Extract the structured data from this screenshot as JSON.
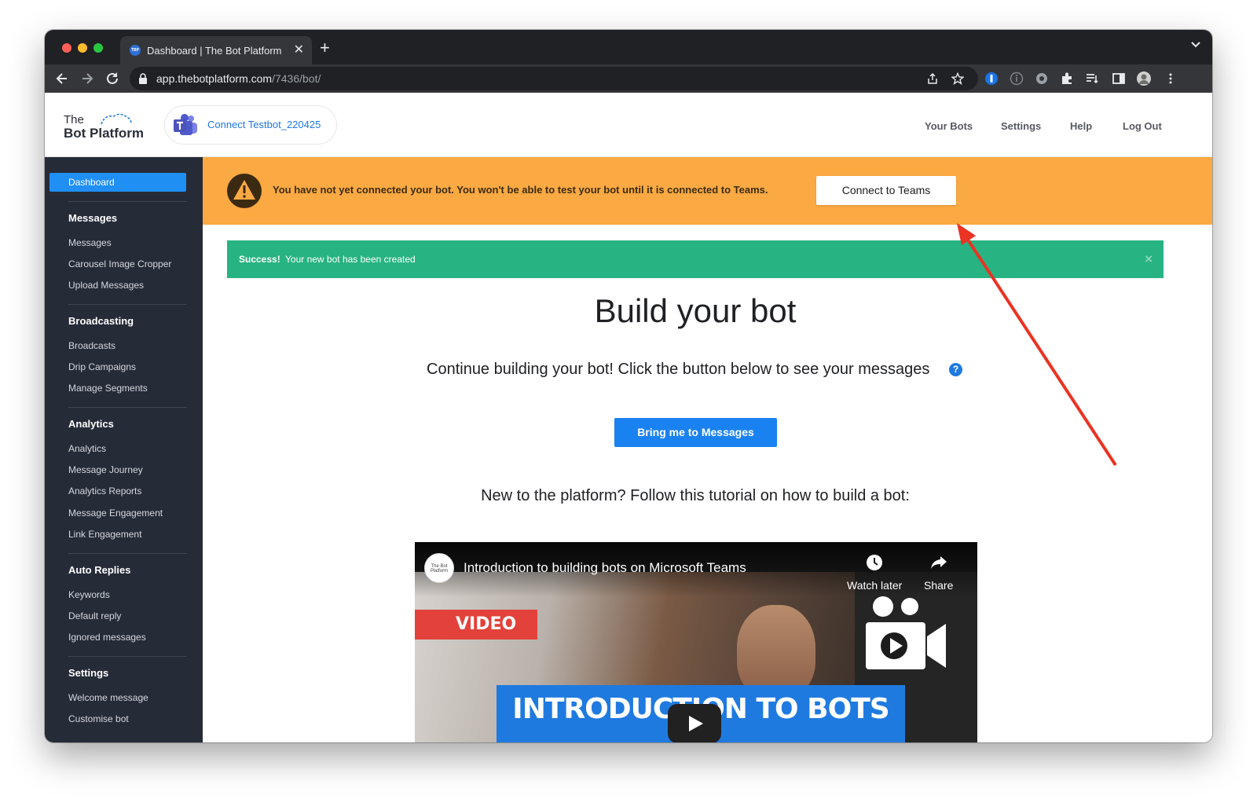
{
  "browser": {
    "tab_favicon_text": "TBP",
    "tab_title": "Dashboard | The Bot Platform",
    "tab_close": "✕",
    "new_tab": "+",
    "url_host": "app.thebotplatform.com",
    "url_path": "/7436/bot/"
  },
  "header": {
    "logo_line1": "The",
    "logo_line2": "Bot Platform",
    "connect_label": "Connect Testbot_220425",
    "nav": [
      "Your Bots",
      "Settings",
      "Help",
      "Log Out"
    ]
  },
  "sidebar": {
    "active": "Dashboard",
    "sections": [
      {
        "heading": "Messages",
        "items": [
          "Messages",
          "Carousel Image Cropper",
          "Upload Messages"
        ]
      },
      {
        "heading": "Broadcasting",
        "items": [
          "Broadcasts",
          "Drip Campaigns",
          "Manage Segments"
        ]
      },
      {
        "heading": "Analytics",
        "items": [
          "Analytics",
          "Message Journey",
          "Analytics Reports",
          "Message Engagement",
          "Link Engagement"
        ]
      },
      {
        "heading": "Auto Replies",
        "items": [
          "Keywords",
          "Default reply",
          "Ignored messages"
        ]
      },
      {
        "heading": "Settings",
        "items": [
          "Welcome message",
          "Customise bot"
        ]
      }
    ]
  },
  "warning": {
    "text": "You have not yet connected your bot. You won't be able to test your bot until it is connected to Teams.",
    "button": "Connect to Teams"
  },
  "success": {
    "strong": "Success!",
    "text": "Your new bot has been created",
    "close": "×"
  },
  "main": {
    "title": "Build your bot",
    "subtitle": "Continue building your bot! Click the button below to see your messages",
    "help_icon": "?",
    "messages_button": "Bring me to Messages",
    "tutorial_text": "New to the platform? Follow this tutorial on how to build a bot:"
  },
  "video": {
    "channel_text": "The Bot Platform",
    "title": "Introduction to building bots on Microsoft Teams",
    "tag": "VIDEO",
    "watch_later": "Watch later",
    "share": "Share",
    "banner": "INTRODUCTION TO BOTS"
  },
  "colors": {
    "warning_bg": "#fba942",
    "success_bg": "#27b382",
    "primary_blue": "#1a82f0",
    "sidebar_bg": "#262b38",
    "annotation_arrow": "#ea3323"
  },
  "icons": [
    "back-icon",
    "forward-icon",
    "reload-icon",
    "lock-icon",
    "share-icon",
    "star-icon",
    "extension-icon",
    "warning-icon",
    "help-icon",
    "clock-icon",
    "share-arrow-icon",
    "camera-icon",
    "play-icon",
    "teams-icon"
  ]
}
